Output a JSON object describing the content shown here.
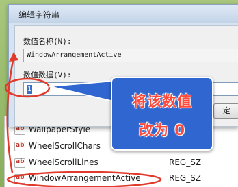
{
  "dialog": {
    "title": "编辑字符串",
    "name_label": "数值名称(N):",
    "name_value": "WindowArrangementActive",
    "data_label": "数值数据(V):",
    "data_value": "1",
    "partial_button": "定"
  },
  "registry_list": {
    "items": [
      {
        "name": "WallpaperStyle",
        "type": ""
      },
      {
        "name": "WheelScrollChars",
        "type": ""
      },
      {
        "name": "WheelScrollLines",
        "type": "REG_SZ"
      },
      {
        "name": "WindowArrangementActive",
        "type": "REG_SZ"
      }
    ],
    "icon_text": "ab"
  },
  "callout": {
    "line1": "将该数值",
    "line2": "改为 0"
  },
  "colors": {
    "annotation_red": "#e23a2a",
    "callout_blue": "#2f66d0",
    "border_green": "#8fb46a"
  }
}
